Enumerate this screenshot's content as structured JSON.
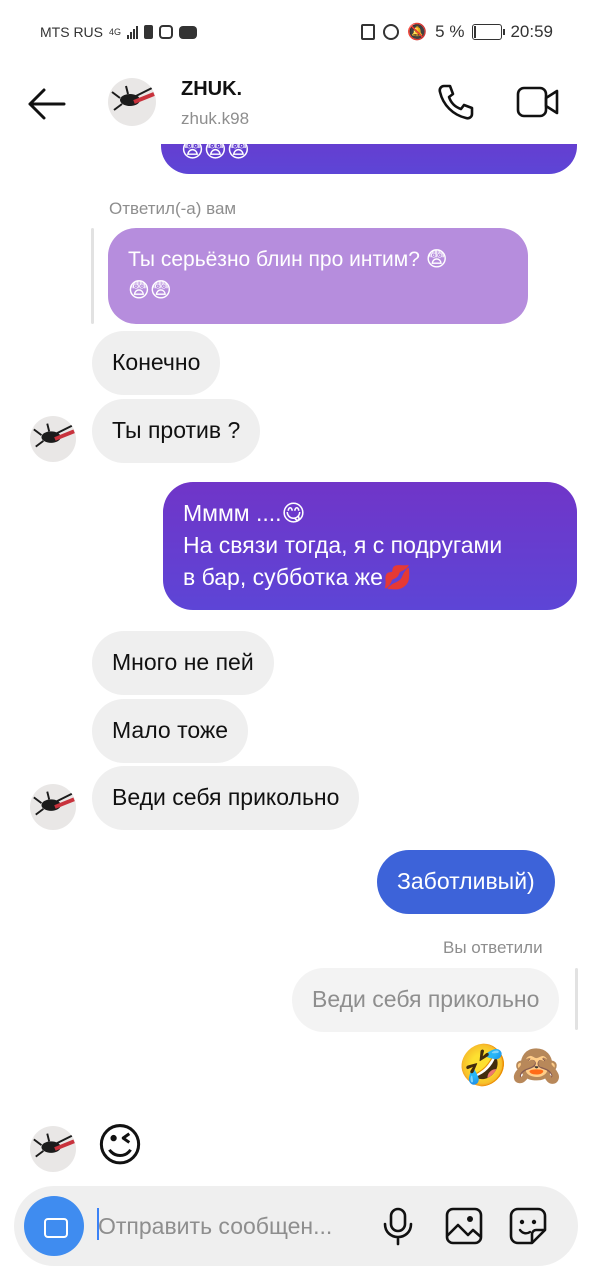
{
  "status_bar": {
    "carrier": "MTS RUS",
    "network": "4G",
    "battery_percent": "5 %",
    "time": "20:59"
  },
  "header": {
    "name": "ZHUK.",
    "username": "zhuk.k98"
  },
  "messages": {
    "reply_label_1": "Ответил(-а) вам",
    "reply_quote_1_line1": "Ты серьёзно блин про интим? 😨",
    "reply_quote_1_line2": "😨😨",
    "in_1": "Конечно",
    "in_2": "Ты против ?",
    "out_1_line1": "Мммм ....😋",
    "out_1_line2": "На связи тогда, я с подругами",
    "out_1_line3": "в бар, субботка же💋",
    "in_3": "Много не пей",
    "in_4": "Мало тоже",
    "in_5": "Веди себя прикольно",
    "out_2": "Заботливый)",
    "reply_label_2": "Вы ответили",
    "reply_quote_2": "Веди себя прикольно",
    "out_emoji": "🤣🙈",
    "in_emoji": "😉",
    "top_partial_emoji": "😨😨😨"
  },
  "composer": {
    "placeholder": "Отправить сообщен..."
  },
  "colors": {
    "outgoing_purple": "#6a3ad6",
    "outgoing_blue": "#3d63d9",
    "reply_purple": "#b68ddd",
    "incoming_grey": "#efefef",
    "camera_button": "#3f8cf0"
  }
}
